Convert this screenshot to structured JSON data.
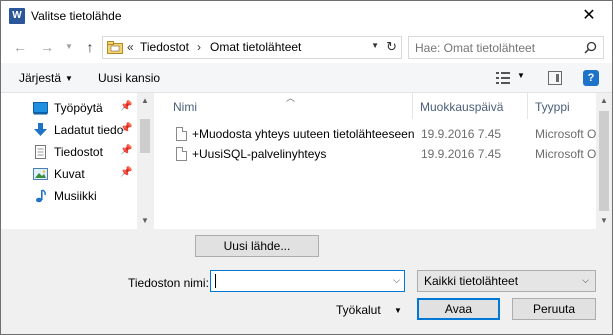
{
  "window": {
    "title": "Valitse tietolähde",
    "app_icon_letter": "W"
  },
  "nav": {
    "back_icon": "back-arrow-icon",
    "forward_icon": "forward-arrow-icon",
    "up_icon": "up-arrow-icon",
    "breadcrumb": {
      "overflow": "«",
      "items": [
        "Tiedostot",
        "Omat tietolähteet"
      ]
    },
    "search_placeholder": "Hae: Omat tietolähteet"
  },
  "toolbar": {
    "organize": "Järjestä",
    "new_folder": "Uusi kansio"
  },
  "sidebar": {
    "items": [
      {
        "label": "Työpöytä",
        "icon": "desktop-icon",
        "pinned": true
      },
      {
        "label": "Ladatut tiedo",
        "icon": "download-icon",
        "pinned": true
      },
      {
        "label": "Tiedostot",
        "icon": "documents-icon",
        "pinned": true
      },
      {
        "label": "Kuvat",
        "icon": "pictures-icon",
        "pinned": true
      },
      {
        "label": "Musiikki",
        "icon": "music-icon",
        "pinned": false
      }
    ]
  },
  "filelist": {
    "columns": {
      "name": "Nimi",
      "date": "Muokkauspäivä",
      "type": "Tyyppi"
    },
    "rows": [
      {
        "name": "+Muodosta yhteys uuteen tietolähteeseen",
        "date": "19.9.2016 7.45",
        "type": "Microsoft Office"
      },
      {
        "name": "+UusiSQL-palvelinyhteys",
        "date": "19.9.2016 7.45",
        "type": "Microsoft Office"
      }
    ]
  },
  "bottom": {
    "new_source_button": "Uusi lähde...",
    "filename_label": "Tiedoston nimi:",
    "filename_value": "",
    "filetype_value": "Kaikki tietolähteet",
    "tools": "Työkalut",
    "open_button": "Avaa",
    "cancel_button": "Peruuta"
  },
  "colors": {
    "accent": "#0078d7",
    "help": "#1e73c9",
    "header_text": "#4c607a"
  }
}
